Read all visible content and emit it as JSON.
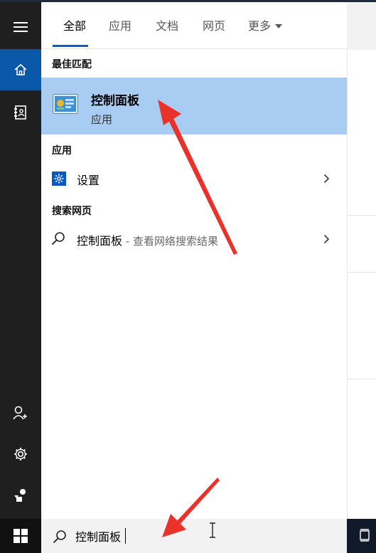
{
  "tabs": [
    {
      "label": "全部"
    },
    {
      "label": "应用"
    },
    {
      "label": "文档"
    },
    {
      "label": "网页"
    },
    {
      "label": "更多"
    }
  ],
  "sections": {
    "best_match": "最佳匹配",
    "apps": "应用",
    "web": "搜索网页"
  },
  "best_match_item": {
    "title": "控制面板",
    "subtitle": "应用"
  },
  "app_items": [
    {
      "label": "设置"
    }
  ],
  "web_item": {
    "label": "控制面板",
    "suffix": " - 查看网络搜索结果"
  },
  "search": {
    "value": "控制面板"
  },
  "rail_icons": [
    "menu-icon",
    "home-icon",
    "notebook-icon",
    "add-user-icon",
    "settings-gear-icon",
    "feedback-icon"
  ],
  "colors": {
    "accent": "#0a58a8",
    "highlight": "#a9cdf2",
    "annotation": "#e8322a"
  }
}
